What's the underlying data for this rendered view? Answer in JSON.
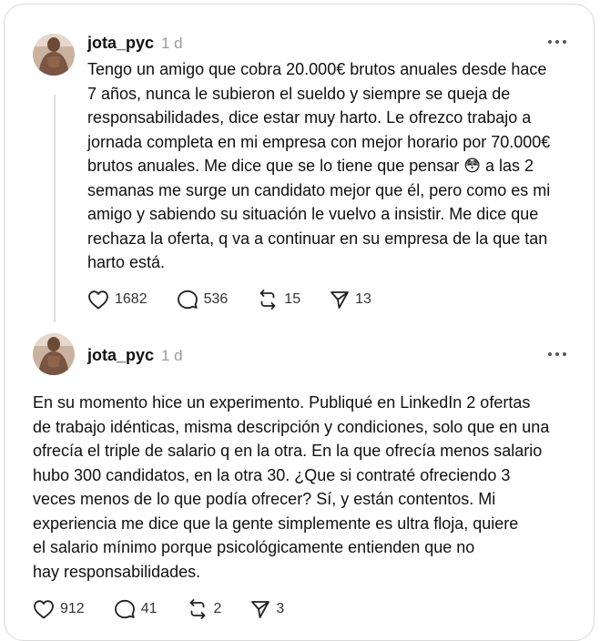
{
  "posts": [
    {
      "username": "jota_pyc",
      "time": "1 d",
      "text": "Tengo un amigo que cobra 20.000€ brutos anuales desde hace\n7 años, nunca le subieron el sueldo y siempre se queja de\nresponsabilidades, dice estar muy harto. Le ofrezco trabajo a\njornada completa en mi empresa con mejor horario por 70.000€\nbrutos anuales. Me dice que se lo tiene que pensar 😳 a las 2\nsemanas me surge un candidato mejor que él, pero como es mi\namigo y sabiendo su situación le vuelvo a insistir. Me dice que\nrechaza la oferta, q va a continuar en su empresa de la que tan\nharto está.",
      "likes": "1682",
      "replies": "536",
      "reposts": "15",
      "shares": "13"
    },
    {
      "username": "jota_pyc",
      "time": "1 d",
      "text": "En su momento hice un experimento. Publiqué en LinkedIn 2 ofertas\nde trabajo idénticas, misma descripción y condiciones, solo que en una\nofrecía el triple de salario q en la otra. En la que ofrecía menos salario\nhubo 300 candidatos, en la otra 30. ¿Que si contraté ofreciendo 3\nveces menos de lo que podía ofrecer? Sí, y están contentos. Mi\nexperiencia me dice que la gente simplemente es ultra floja, quiere\nel salario mínimo porque psicológicamente entienden que no\nhay responsabilidades.",
      "likes": "912",
      "replies": "41",
      "reposts": "2",
      "shares": "3"
    }
  ],
  "icons": {
    "like": "heart-icon",
    "reply": "comment-icon",
    "repost": "repost-icon",
    "share": "send-icon",
    "more": "more-icon"
  }
}
